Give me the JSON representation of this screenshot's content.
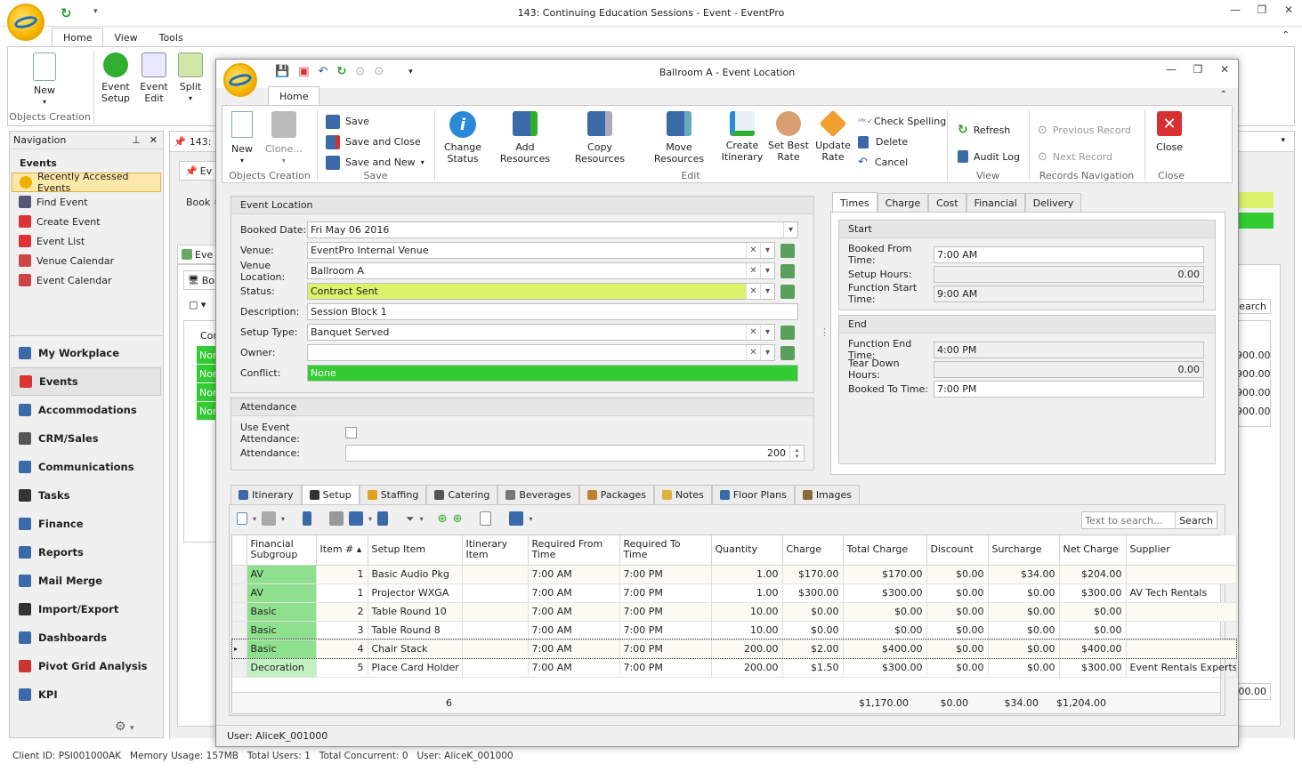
{
  "main_window": {
    "title": "143: Continuing Education Sessions - Event - EventPro",
    "menu_tabs": [
      "Home",
      "View",
      "Tools"
    ],
    "ribbon": {
      "new_label": "New",
      "event_setup_label": "Event Setup",
      "event_edit_label": "Event Edit",
      "split_label": "Split",
      "group_label": "Objects Creation"
    },
    "doc_tab_label": "143:",
    "inner_tab_label": "Ev",
    "book_label": "Book #",
    "inner_tab2_label": "Eve",
    "inner_tab3_label": "Bo",
    "grid_col_label": "Cor",
    "grid_cells": [
      "Nor",
      "Nor",
      "Nor",
      "Nor"
    ],
    "right_values": [
      "900.00",
      "900.00",
      "900.00",
      "900.00"
    ],
    "right_bottom_value": "00.00",
    "search_fragment": "earch",
    "status_bar": {
      "client_id": "Client ID: PSI001000AK",
      "memory": "Memory Usage: 157MB",
      "total_users": "Total Users: 1",
      "total_concurrent": "Total Concurrent: 0",
      "user": "User: AliceK_001000"
    }
  },
  "navigation": {
    "title": "Navigation",
    "section_title": "Events",
    "items": [
      {
        "label": "Recently Accessed Events",
        "selected": true
      },
      {
        "label": "Find Event"
      },
      {
        "label": "Create Event"
      },
      {
        "label": "Event List"
      },
      {
        "label": "Venue Calendar"
      },
      {
        "label": "Event Calendar"
      }
    ],
    "modules": [
      {
        "label": "My Workplace"
      },
      {
        "label": "Events",
        "selected": true
      },
      {
        "label": "Accommodations"
      },
      {
        "label": "CRM/Sales"
      },
      {
        "label": "Communications"
      },
      {
        "label": "Tasks"
      },
      {
        "label": "Finance"
      },
      {
        "label": "Reports"
      },
      {
        "label": "Mail Merge"
      },
      {
        "label": "Import/Export"
      },
      {
        "label": "Dashboards"
      },
      {
        "label": "Pivot Grid Analysis"
      },
      {
        "label": "KPI"
      }
    ]
  },
  "dialog": {
    "title": "Ballroom A - Event Location",
    "tab": "Home",
    "ribbon": {
      "new": "New",
      "clone": "Clone...",
      "objects_creation": "Objects Creation",
      "save": "Save",
      "save_close": "Save and Close",
      "save_new": "Save and New",
      "save_group": "Save",
      "change_status": "Change Status",
      "add_resources": "Add Resources",
      "copy_resources": "Copy Resources",
      "move_resources": "Move Resources",
      "create_itinerary": "Create Itinerary",
      "set_best_rate": "Set Best Rate",
      "update_rate": "Update Rate",
      "check_spelling": "Check Spelling",
      "delete": "Delete",
      "cancel": "Cancel",
      "edit_group": "Edit",
      "refresh": "Refresh",
      "audit_log": "Audit Log",
      "view_group": "View",
      "previous_record": "Previous Record",
      "next_record": "Next Record",
      "records_group": "Records Navigation",
      "close": "Close",
      "close_group": "Close"
    },
    "event_location": {
      "title": "Event Location",
      "booked_date_label": "Booked Date:",
      "booked_date": "Fri May 06 2016",
      "venue_label": "Venue:",
      "venue": "EventPro Internal Venue",
      "venue_location_label": "Venue Location:",
      "venue_location": "Ballroom A",
      "status_label": "Status:",
      "status": "Contract Sent",
      "description_label": "Description:",
      "description": "Session Block 1",
      "setup_type_label": "Setup Type:",
      "setup_type": "Banquet Served",
      "owner_label": "Owner:",
      "owner": "",
      "conflict_label": "Conflict:",
      "conflict": "None"
    },
    "attendance": {
      "title": "Attendance",
      "use_label": "Use Event Attendance:",
      "attendance_label": "Attendance:",
      "attendance": "200"
    },
    "right_tabs": [
      "Times",
      "Charge",
      "Cost",
      "Financial",
      "Delivery"
    ],
    "times": {
      "start_title": "Start",
      "booked_from_label": "Booked From Time:",
      "booked_from": "7:00 AM",
      "setup_hours_label": "Setup Hours:",
      "setup_hours": "0.00",
      "function_start_label": "Function Start Time:",
      "function_start": "9:00 AM",
      "end_title": "End",
      "function_end_label": "Function End Time:",
      "function_end": "4:00 PM",
      "teardown_label": "Tear Down Hours:",
      "teardown": "0.00",
      "booked_to_label": "Booked To Time:",
      "booked_to": "7:00 PM"
    },
    "bottom_tabs": [
      "Itinerary",
      "Setup",
      "Staffing",
      "Catering",
      "Beverages",
      "Packages",
      "Notes",
      "Floor Plans",
      "Images"
    ],
    "search_placeholder": "Text to search...",
    "search_button": "Search",
    "grid": {
      "headers": [
        "Financial Subgroup",
        "Item #",
        "Setup Item",
        "Itinerary Item",
        "Required From Time",
        "Required To Time",
        "Quantity",
        "Charge",
        "Total Charge",
        "Discount",
        "Surcharge",
        "Net Charge",
        "Supplier"
      ],
      "rows": [
        [
          "AV",
          "1",
          "Basic Audio Pkg",
          "",
          "7:00 AM",
          "7:00 PM",
          "1.00",
          "$170.00",
          "$170.00",
          "$0.00",
          "$34.00",
          "$204.00",
          ""
        ],
        [
          "AV",
          "1",
          "Projector WXGA",
          "",
          "7:00 AM",
          "7:00 PM",
          "1.00",
          "$300.00",
          "$300.00",
          "$0.00",
          "$0.00",
          "$300.00",
          "AV Tech Rentals"
        ],
        [
          "Basic",
          "2",
          "Table Round 10",
          "",
          "7:00 AM",
          "7:00 PM",
          "10.00",
          "$0.00",
          "$0.00",
          "$0.00",
          "$0.00",
          "$0.00",
          ""
        ],
        [
          "Basic",
          "3",
          "Table Round 8",
          "",
          "7:00 AM",
          "7:00 PM",
          "10.00",
          "$0.00",
          "$0.00",
          "$0.00",
          "$0.00",
          "$0.00",
          ""
        ],
        [
          "Basic",
          "4",
          "Chair Stack",
          "",
          "7:00 AM",
          "7:00 PM",
          "200.00",
          "$2.00",
          "$400.00",
          "$0.00",
          "$0.00",
          "$400.00",
          ""
        ],
        [
          "Decoration",
          "5",
          "Place Card Holder",
          "",
          "7:00 AM",
          "7:00 PM",
          "200.00",
          "$1.50",
          "$300.00",
          "$0.00",
          "$0.00",
          "$300.00",
          "Event Rentals Experts"
        ]
      ],
      "footer": {
        "count": "6",
        "total_charge": "$1,170.00",
        "discount": "$0.00",
        "surcharge": "$34.00",
        "net_charge": "$1,204.00"
      }
    },
    "status_user": "User: AliceK_001000"
  },
  "colors": {
    "status_yellow": "#dbf26a",
    "conflict_green": "#33cc33",
    "av_green": "#8ee08e",
    "decoration_green": "#c2f0c2"
  }
}
